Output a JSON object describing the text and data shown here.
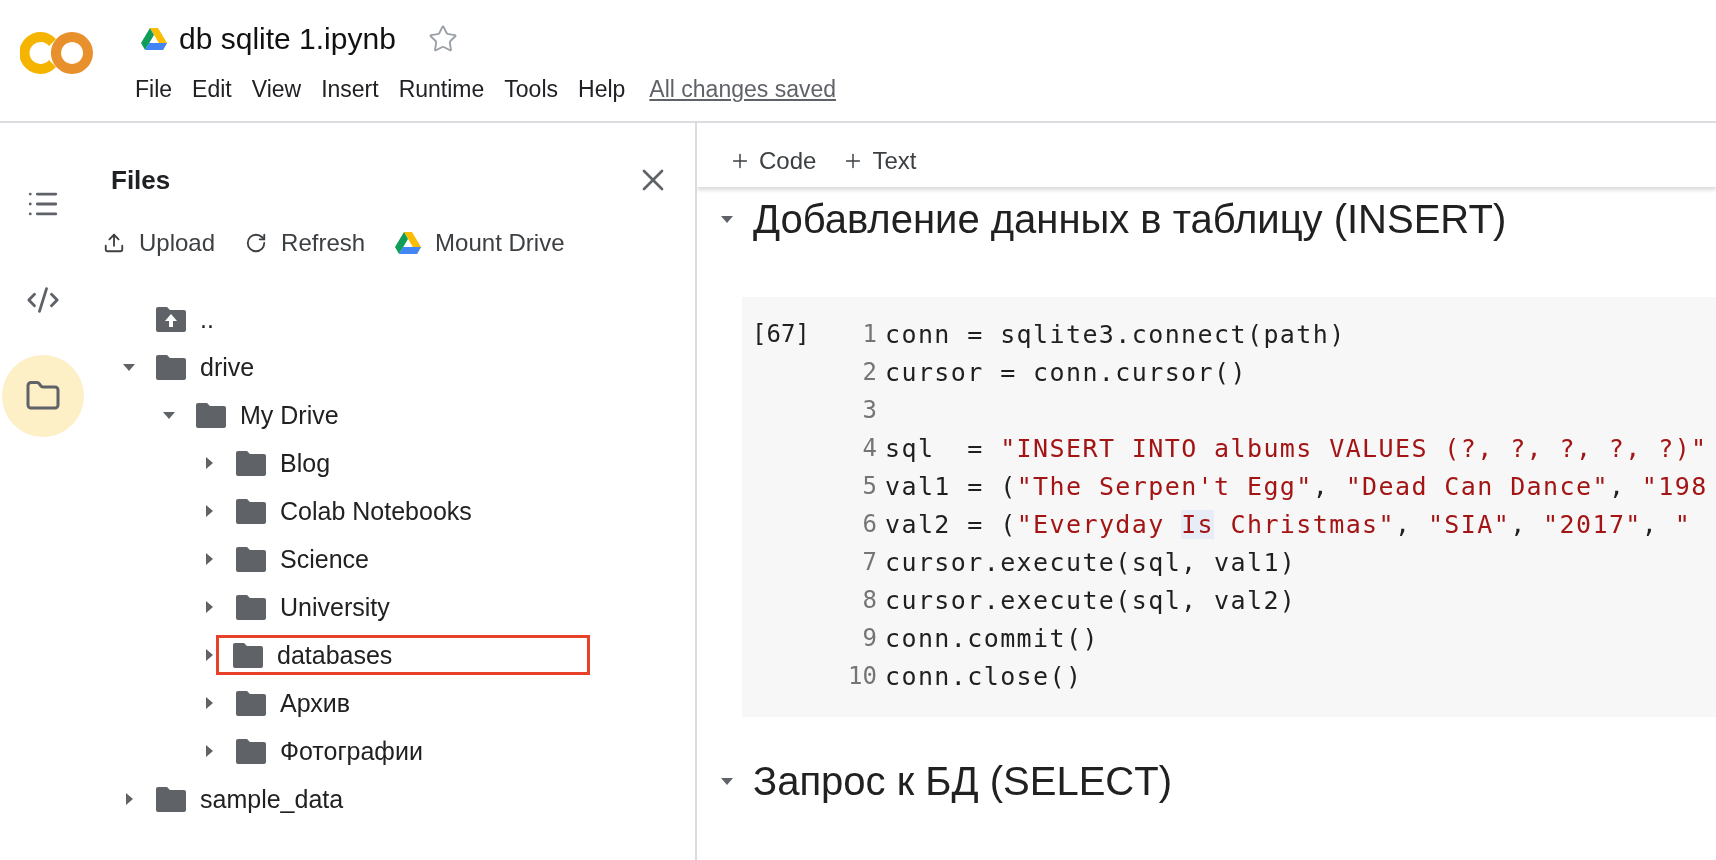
{
  "header": {
    "title": "db  sqlite  1.ipynb",
    "starred": false,
    "menu": [
      "File",
      "Edit",
      "View",
      "Insert",
      "Runtime",
      "Tools",
      "Help"
    ],
    "save_status": "All changes saved"
  },
  "rail": [
    {
      "kind": "toc",
      "selected": false
    },
    {
      "kind": "code",
      "selected": false
    },
    {
      "kind": "files",
      "selected": true
    }
  ],
  "files_panel": {
    "title": "Files",
    "actions": [
      {
        "kind": "upload",
        "label": "Upload"
      },
      {
        "kind": "refresh",
        "label": "Refresh"
      },
      {
        "kind": "drive",
        "label": "Mount Drive"
      }
    ],
    "tree": [
      {
        "kind": "up",
        "name": ".."
      },
      {
        "kind": "folder",
        "name": "drive",
        "expanded": true,
        "children": [
          {
            "kind": "folder",
            "name": "My Drive",
            "expanded": true,
            "children": [
              {
                "kind": "folder",
                "name": "Blog",
                "expanded": false
              },
              {
                "kind": "folder",
                "name": "Colab Notebooks",
                "expanded": false
              },
              {
                "kind": "folder",
                "name": "Science",
                "expanded": false
              },
              {
                "kind": "folder",
                "name": "University",
                "expanded": false
              },
              {
                "kind": "folder",
                "name": "databases",
                "expanded": false,
                "highlighted": true
              },
              {
                "kind": "folder",
                "name": "Архив",
                "expanded": false
              },
              {
                "kind": "folder",
                "name": "Фотографии",
                "expanded": false
              }
            ]
          }
        ]
      },
      {
        "kind": "folder",
        "name": "sample_data",
        "expanded": false
      }
    ]
  },
  "toolbar": [
    "Code",
    "Text"
  ],
  "sections": [
    {
      "title": "Добавление данных в таблицу (INSERT)",
      "expanded": true,
      "cell": {
        "count": "[67]",
        "lines": [
          {
            "number": "1",
            "tokens": [
              {
                "kind": "code",
                "text": "conn = sqlite3.connect(path)"
              }
            ]
          },
          {
            "number": "2",
            "tokens": [
              {
                "kind": "code",
                "text": "cursor = conn.cursor()"
              }
            ]
          },
          {
            "number": "3"
          },
          {
            "number": "4",
            "tokens": [
              {
                "kind": "code",
                "text": "sql  = "
              },
              {
                "kind": "string",
                "text": "\"INSERT INTO albums VALUES (?, ?, ?, ?, ?)\""
              }
            ]
          },
          {
            "number": "5",
            "tokens": [
              {
                "kind": "code",
                "text": "val1 = ("
              },
              {
                "kind": "string",
                "text": "\"The Serpen't Egg\""
              },
              {
                "kind": "code",
                "text": ", "
              },
              {
                "kind": "string",
                "text": "\"Dead Can Dance\""
              },
              {
                "kind": "code",
                "text": ", "
              },
              {
                "kind": "string",
                "text": "\"198"
              }
            ]
          },
          {
            "number": "6",
            "tokens": [
              {
                "kind": "code",
                "text": "val2 = ("
              },
              {
                "kind": "string",
                "text": "\"Everyday "
              },
              {
                "kind": "match",
                "text": "Is"
              },
              {
                "kind": "string",
                "text": " Christmas\""
              },
              {
                "kind": "code",
                "text": ", "
              },
              {
                "kind": "string",
                "text": "\"SIA\""
              },
              {
                "kind": "code",
                "text": ", "
              },
              {
                "kind": "string",
                "text": "\"2017\""
              },
              {
                "kind": "code",
                "text": ", "
              },
              {
                "kind": "string",
                "text": "\""
              }
            ]
          },
          {
            "number": "7",
            "tokens": [
              {
                "kind": "code",
                "text": "cursor.execute(sql, val1)"
              }
            ]
          },
          {
            "number": "8",
            "tokens": [
              {
                "kind": "code",
                "text": "cursor.execute(sql, val2)"
              }
            ]
          },
          {
            "number": "9",
            "tokens": [
              {
                "kind": "code",
                "text": "conn.commit()"
              }
            ]
          },
          {
            "number": "10",
            "tokens": [
              {
                "kind": "code",
                "text": "conn.close()"
              }
            ]
          }
        ]
      }
    },
    {
      "title": "Запрос к БД (SELECT)",
      "expanded": true
    }
  ]
}
